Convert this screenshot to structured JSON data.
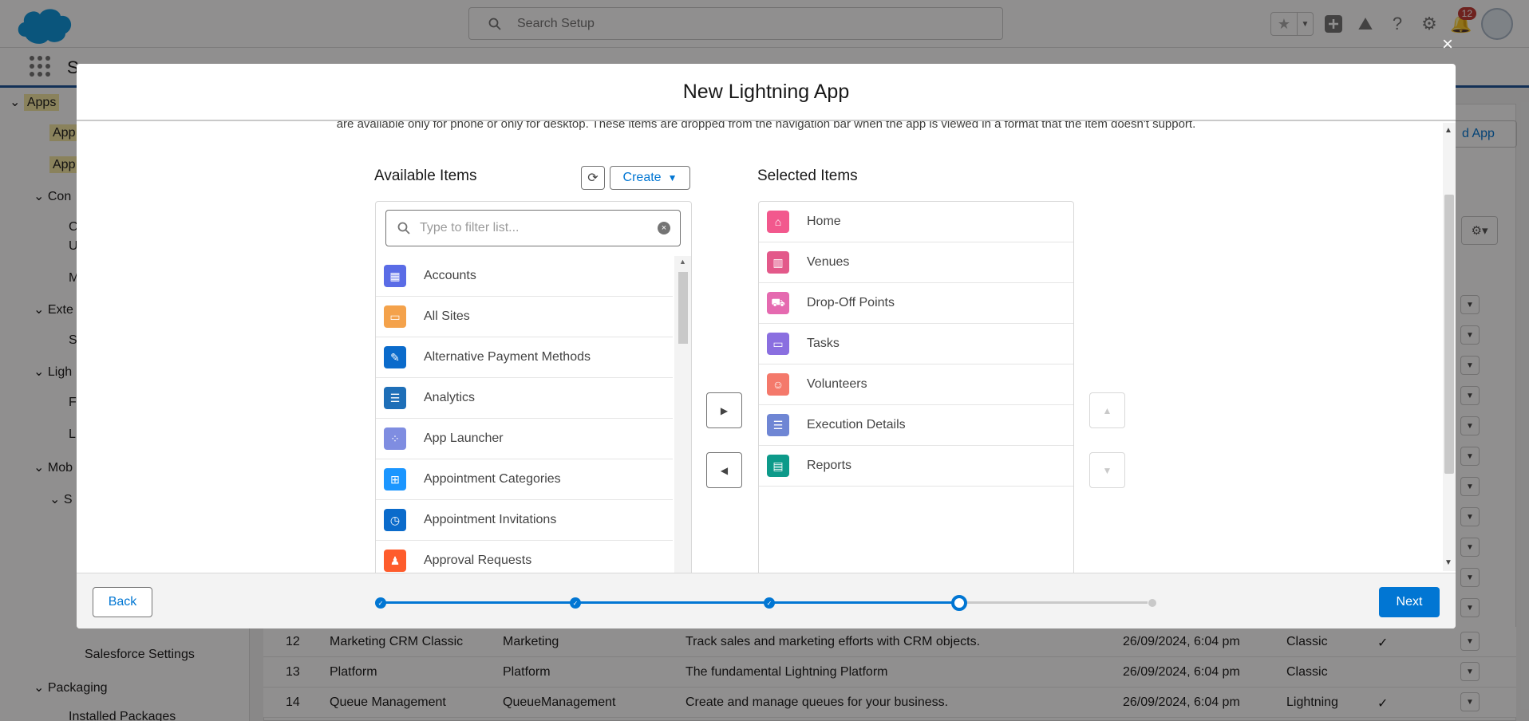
{
  "header": {
    "search_placeholder": "Search Setup",
    "notification_count": "12"
  },
  "sidebar": {
    "items": [
      {
        "label": "Apps"
      },
      {
        "label": "App"
      },
      {
        "label": "App"
      },
      {
        "label": "Con"
      },
      {
        "label": "C"
      },
      {
        "label": "U"
      },
      {
        "label": "M"
      },
      {
        "label": "Exte"
      },
      {
        "label": "S"
      },
      {
        "label": "Ligh"
      },
      {
        "label": "F"
      },
      {
        "label": "L"
      },
      {
        "label": "Mob"
      },
      {
        "label": "S"
      },
      {
        "label": "Salesforce Settings"
      },
      {
        "label": "Packaging"
      },
      {
        "label": "Installed Packages"
      }
    ]
  },
  "page": {
    "new_app_button_partial": "d App",
    "nav_partial": "Se"
  },
  "table": {
    "rows": [
      {
        "num": "12",
        "app_name": "Marketing CRM Classic",
        "dev_name": "Marketing",
        "description": "Track sales and marketing efforts with CRM objects.",
        "modified": "26/09/2024, 6:04 pm",
        "type": "Classic",
        "checked": "✓"
      },
      {
        "num": "13",
        "app_name": "Platform",
        "dev_name": "Platform",
        "description": "The fundamental Lightning Platform",
        "modified": "26/09/2024, 6:04 pm",
        "type": "Classic",
        "checked": ""
      },
      {
        "num": "14",
        "app_name": "Queue Management",
        "dev_name": "QueueManagement",
        "description": "Create and manage queues for your business.",
        "modified": "26/09/2024, 6:04 pm",
        "type": "Lightning",
        "checked": "✓"
      }
    ]
  },
  "modal": {
    "title": "New Lightning App",
    "intro": "are available only for phone or only for desktop. These items are dropped from the navigation bar when the app is viewed in a format that the item doesn't support.",
    "available_title": "Available Items",
    "create_label": "Create",
    "filter_placeholder": "Type to filter list...",
    "selected_title": "Selected Items",
    "available_items": [
      {
        "label": "Accounts",
        "icon": "accounts-icon",
        "color": "#5a6ce6"
      },
      {
        "label": "All Sites",
        "icon": "sites-icon",
        "color": "#f4a24b"
      },
      {
        "label": "Alternative Payment Methods",
        "icon": "payment-icon",
        "color": "#0b6bcb"
      },
      {
        "label": "Analytics",
        "icon": "analytics-icon",
        "color": "#1e6fb8"
      },
      {
        "label": "App Launcher",
        "icon": "app-launcher-icon",
        "color": "#7f8de1"
      },
      {
        "label": "Appointment Categories",
        "icon": "categories-icon",
        "color": "#1b96ff"
      },
      {
        "label": "Appointment Invitations",
        "icon": "invitation-icon",
        "color": "#0b6bcb"
      },
      {
        "label": "Approval Requests",
        "icon": "approval-icon",
        "color": "#fe5c2c"
      }
    ],
    "selected_items": [
      {
        "label": "Home",
        "icon": "home-icon",
        "color": "#f2588d"
      },
      {
        "label": "Venues",
        "icon": "building-icon",
        "color": "#e3598a"
      },
      {
        "label": "Drop-Off Points",
        "icon": "dropoff-icon",
        "color": "#e56ab0"
      },
      {
        "label": "Tasks",
        "icon": "monitor-icon",
        "color": "#8a6fe0"
      },
      {
        "label": "Volunteers",
        "icon": "people-icon",
        "color": "#f4796b"
      },
      {
        "label": "Execution Details",
        "icon": "details-icon",
        "color": "#6f86d4"
      },
      {
        "label": "Reports",
        "icon": "reports-icon",
        "color": "#0d9a8a"
      }
    ],
    "back_label": "Back",
    "next_label": "Next",
    "progress": {
      "total_steps": 5,
      "completed": 3,
      "current": 4
    }
  },
  "colors": {
    "brand": "#0176d3",
    "overlay": "rgba(8,7,7,0.45)"
  }
}
